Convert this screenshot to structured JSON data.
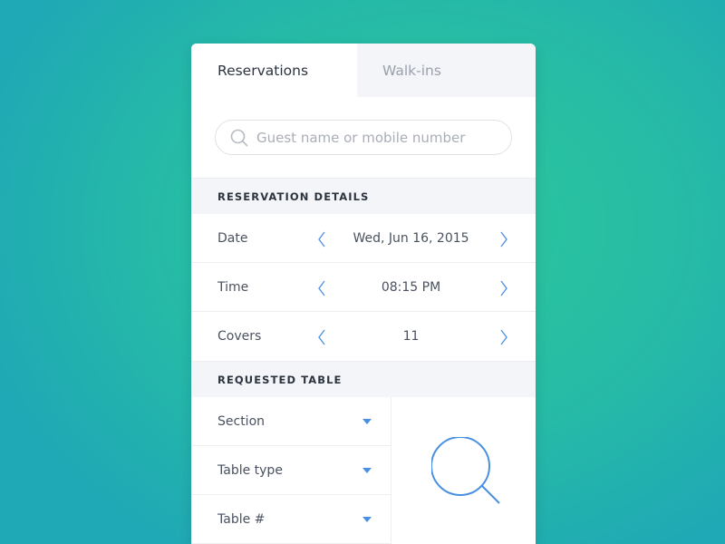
{
  "colors": {
    "accent": "#4a90e2",
    "text": "#2c3440",
    "muted": "#9aa1ad",
    "header_bg": "#f4f5f8"
  },
  "tabs": [
    {
      "label": "Reservations",
      "active": true
    },
    {
      "label": "Walk-ins",
      "active": false
    }
  ],
  "search": {
    "placeholder": "Guest name or mobile number",
    "value": "",
    "icon": "search-icon"
  },
  "reservation_details": {
    "title": "RESERVATION DETAILS",
    "rows": [
      {
        "label": "Date",
        "value": "Wed, Jun 16, 2015"
      },
      {
        "label": "Time",
        "value": "08:15 PM"
      },
      {
        "label": "Covers",
        "value": "11"
      }
    ]
  },
  "requested_table": {
    "title": "REQUESTED TABLE",
    "dropdowns": [
      {
        "label": "Section"
      },
      {
        "label": "Table type"
      },
      {
        "label": "Table #"
      }
    ],
    "preview_icon": "magnifier-icon"
  }
}
